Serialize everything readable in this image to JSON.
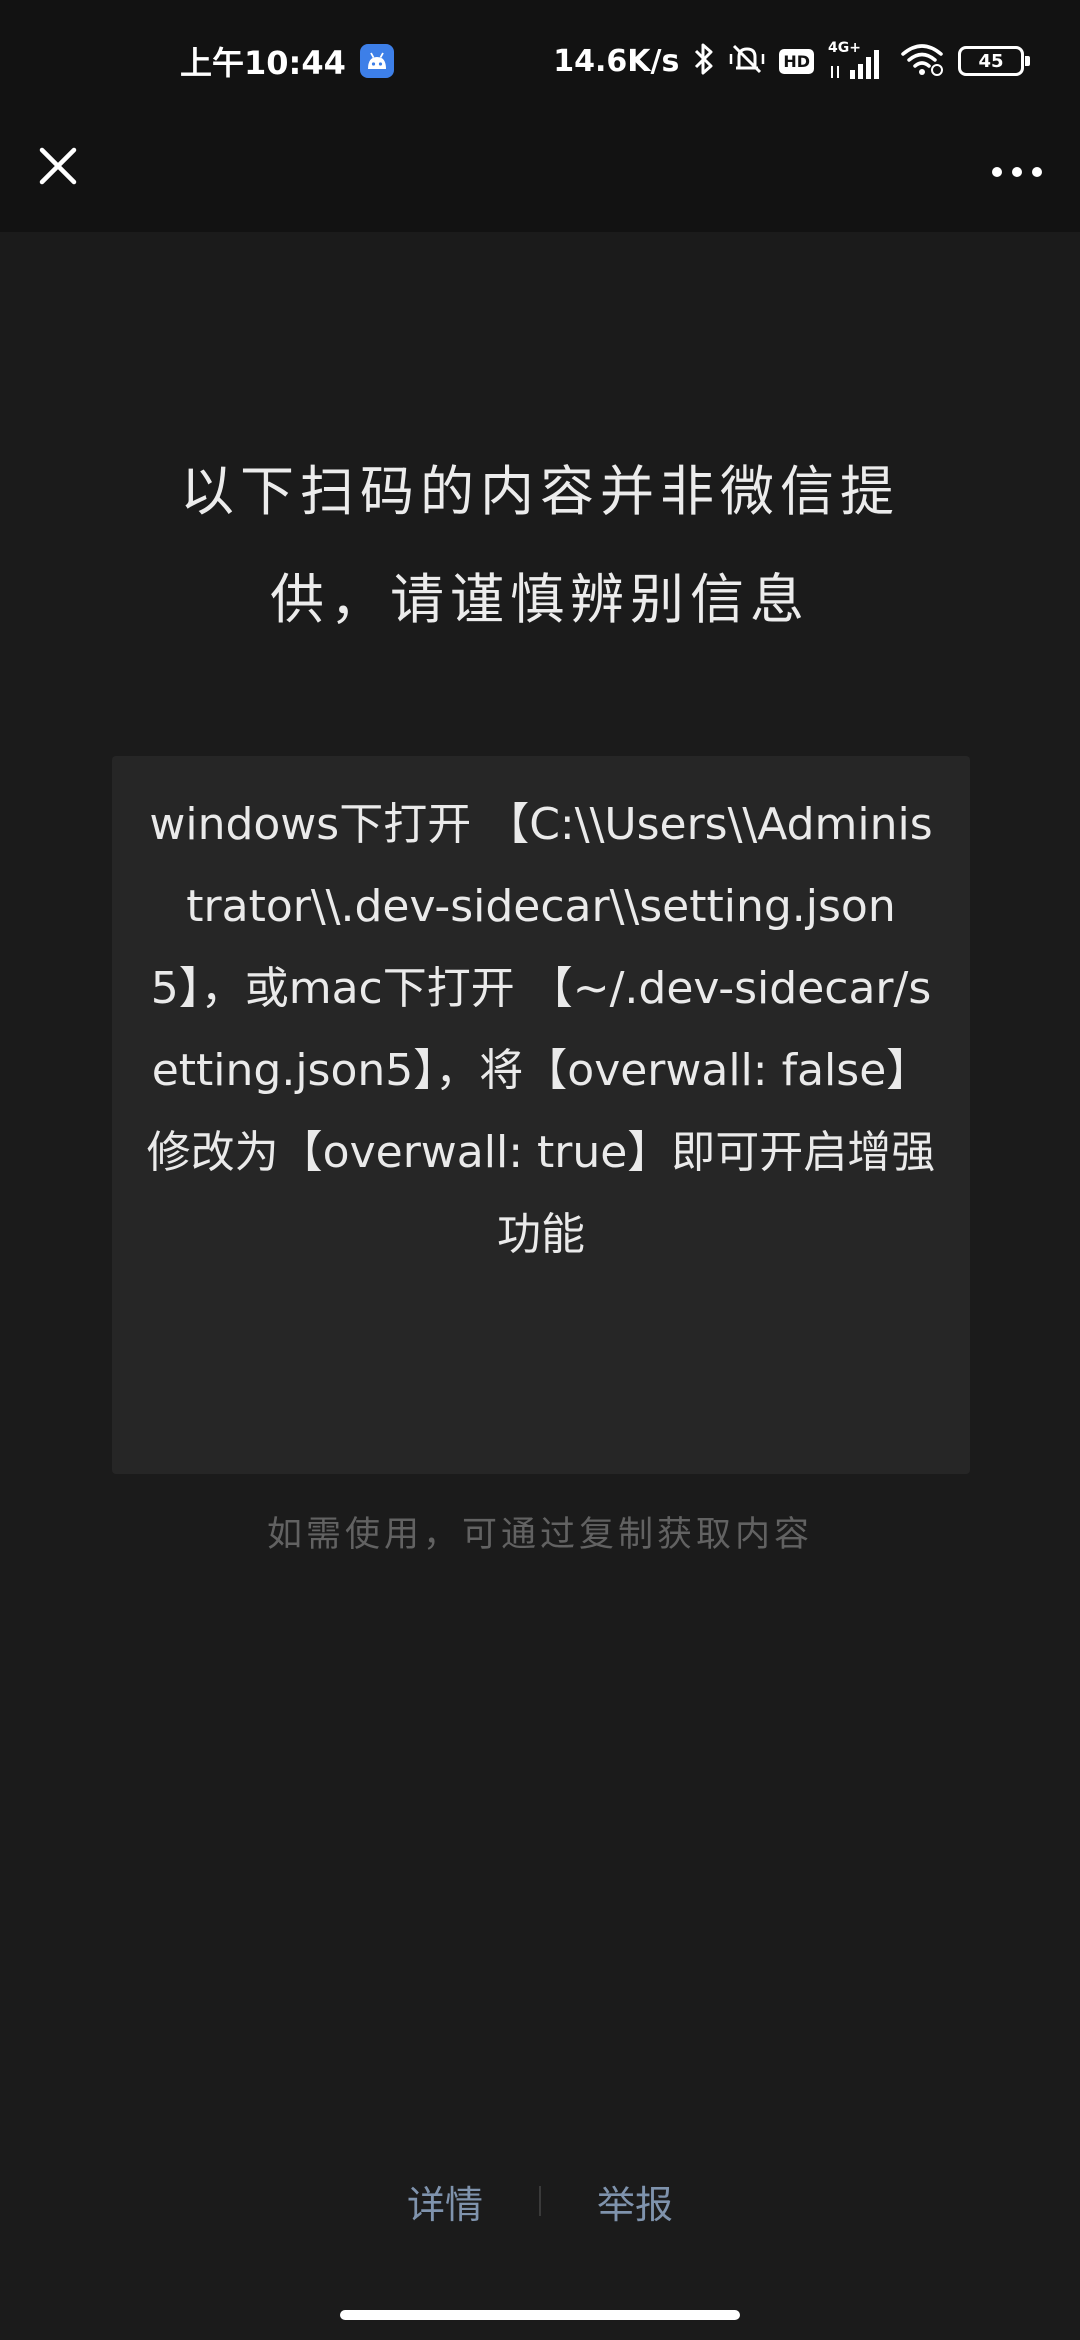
{
  "status_bar": {
    "time": "上午10:44",
    "net_speed": "14.6K/s",
    "network_type": "4G+",
    "hd_label": "HD",
    "battery_level": "45"
  },
  "nav": {
    "close_icon": "close-icon",
    "more_icon": "more-icon"
  },
  "warning": {
    "headline_line1": "以下扫码的内容并非微信提",
    "headline_line2": "供，请谨慎辨别信息"
  },
  "content": {
    "text": "windows下打开 【C:\\\\Users\\\\Administrator\\\\.dev-sidecar\\\\setting.json5】，或mac下打开 【~/.dev-sidecar/setting.json5】，将【overwall: false】修改为【overwall: true】即可开启增强功能"
  },
  "hint": {
    "copy_hint": "如需使用，可通过复制获取内容"
  },
  "footer": {
    "details_label": "详情",
    "report_label": "举报",
    "link_color": "#7f93ad"
  }
}
